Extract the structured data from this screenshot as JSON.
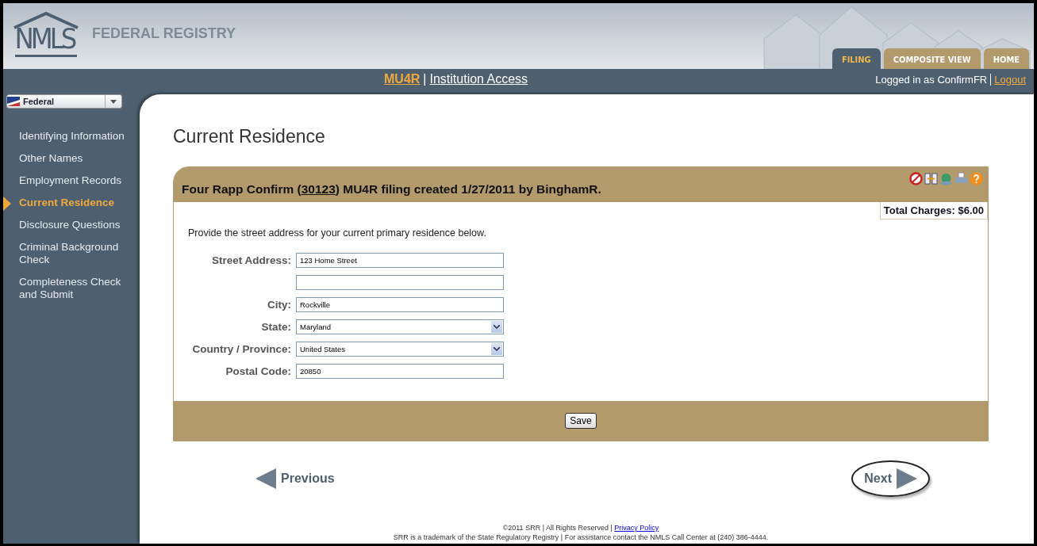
{
  "header": {
    "logo": "NMLS",
    "title": "FEDERAL REGISTRY",
    "tabs": [
      {
        "label": "FILING",
        "selected": true
      },
      {
        "label": "COMPOSITE VIEW",
        "selected": false
      },
      {
        "label": "HOME",
        "selected": false
      }
    ]
  },
  "navbar": {
    "filing_link": "MU4R",
    "separator": "|",
    "access_link": "Institution Access",
    "logged_in": "Logged in as ConfirmFR",
    "logout": "Logout"
  },
  "sidebar": {
    "dropdown": "Federal",
    "items": [
      {
        "label": "Identifying Information",
        "selected": false
      },
      {
        "label": "Other Names",
        "selected": false
      },
      {
        "label": "Employment Records",
        "selected": false
      },
      {
        "label": "Current Residence",
        "selected": true
      },
      {
        "label": "Disclosure Questions",
        "selected": false
      },
      {
        "label": "Criminal Background Check",
        "selected": false
      },
      {
        "label": "Completeness Check and Submit",
        "selected": false
      }
    ]
  },
  "page_title": "Current Residence",
  "panel": {
    "heading_before": "Four Rapp Confirm (",
    "heading_link": "30123",
    "heading_after": ") MU4R filing created 1/27/2011 by BinghamR.",
    "total_charges": "Total Charges: $6.00",
    "instructions": "Provide the street address for your current primary residence below.",
    "fields": [
      {
        "label": "Street Address:",
        "kind": "text",
        "value": "123 Home Street"
      },
      {
        "kind": "text"
      },
      {
        "label": "City:",
        "kind": "text",
        "value": "Rockville"
      },
      {
        "label": "State:",
        "kind": "select",
        "value": "Maryland"
      },
      {
        "label": "Country / Province:",
        "kind": "select",
        "value": "United States"
      },
      {
        "label": "Postal Code:",
        "kind": "text",
        "value": "20850"
      }
    ],
    "save": "Save"
  },
  "pager": {
    "previous": "Previous",
    "next": "Next",
    "next_highlighted": true
  },
  "footer": {
    "line1": "©2011 SRR | All Rights Reserved | ",
    "privacy": "Privacy Policy",
    "line2": "SRR is a trademark of the State Regulatory Registry | For assistance contact the NMLS Call Center at (240) 386-4444."
  }
}
